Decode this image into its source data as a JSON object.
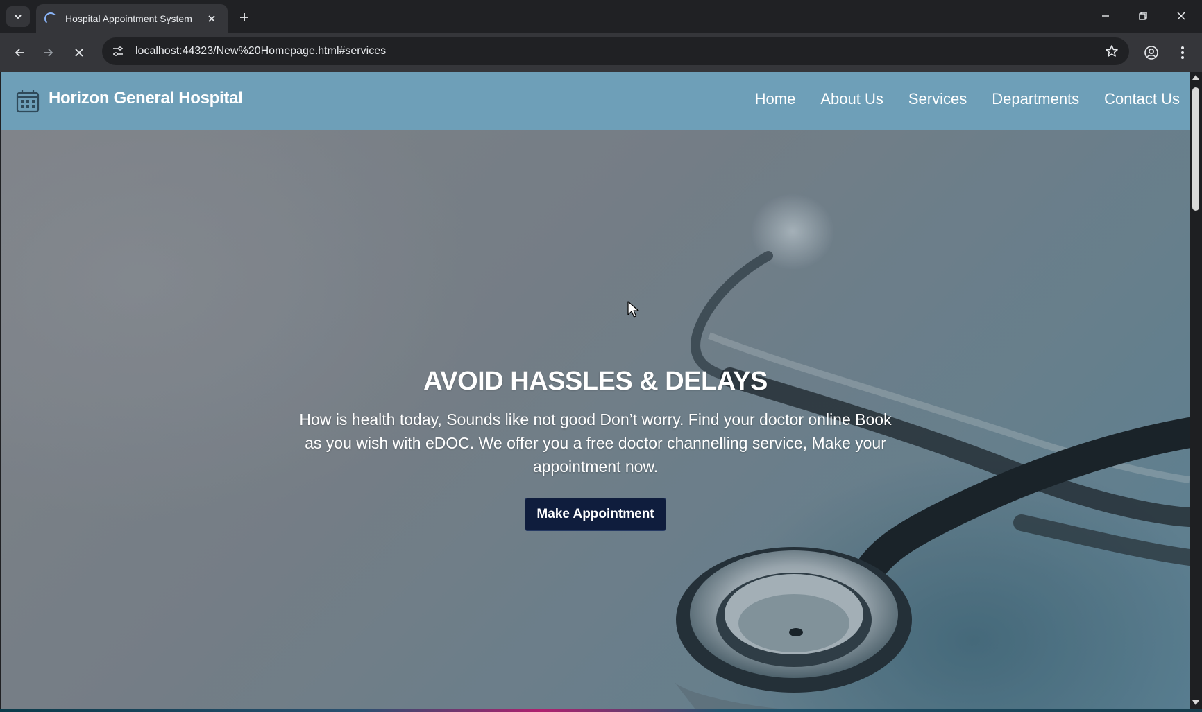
{
  "browser": {
    "tab_title": "Hospital Appointment System",
    "url": "localhost:44323/New%20Homepage.html#services"
  },
  "site": {
    "title": "Horizon General Hospital",
    "nav": [
      {
        "label": "Home"
      },
      {
        "label": "About Us"
      },
      {
        "label": "Services"
      },
      {
        "label": "Departments"
      },
      {
        "label": "Contact Us"
      }
    ]
  },
  "hero": {
    "title": "AVOID HASSLES & DELAYS",
    "text": "How is health today, Sounds like not good Don’t worry. Find your doctor online Book as you wish with eDOC. We offer you a free doctor channelling service, Make your appointment now.",
    "button_label": "Make Appointment"
  },
  "colors": {
    "header_bg": "#6e9fb8",
    "button_bg": "#0f1d3d",
    "chrome_bg": "#202124",
    "toolbar_bg": "#35363a"
  },
  "icons": {
    "logo": "hospital-building-icon",
    "tab_loading": "spinner-icon",
    "back": "arrow-left-icon",
    "forward": "arrow-right-icon",
    "stop": "close-icon",
    "site_info": "tune-icon",
    "bookmark": "star-icon",
    "profile": "account-icon",
    "menu": "more-vertical-icon"
  }
}
